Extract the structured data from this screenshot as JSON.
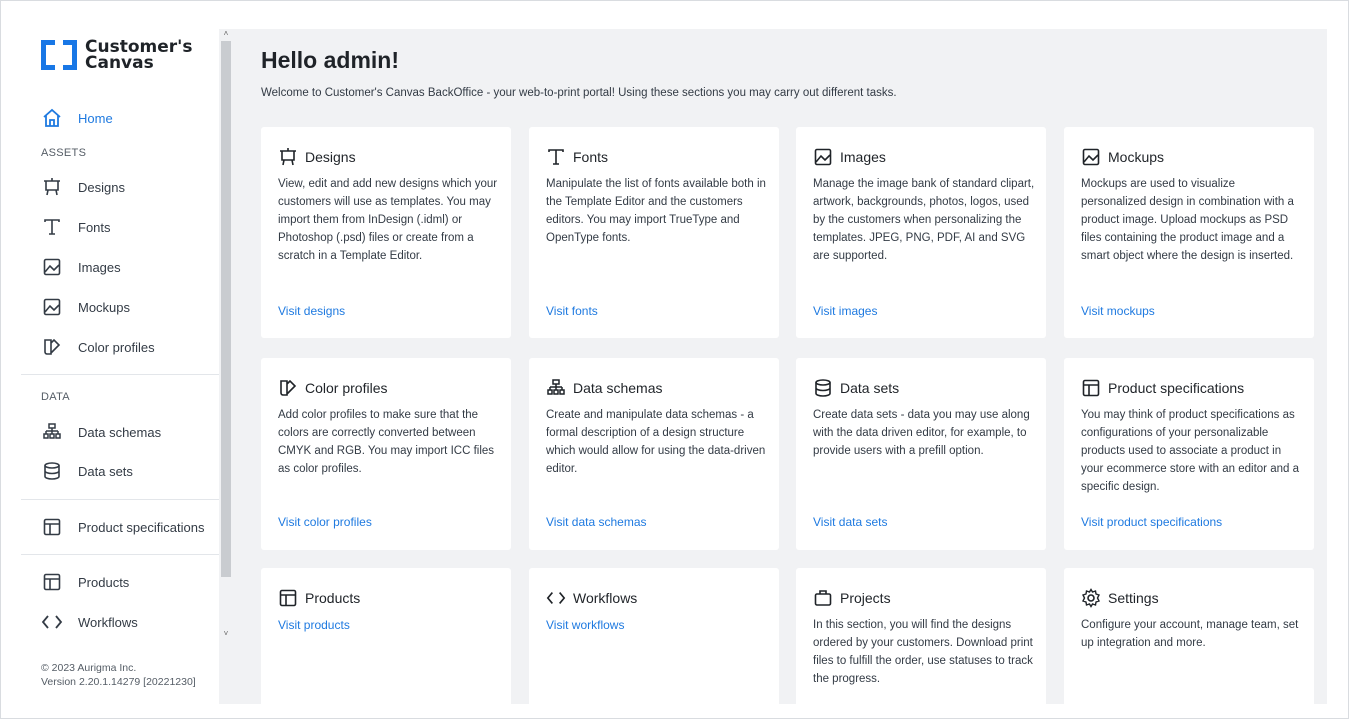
{
  "logo": {
    "line1": "Customer's",
    "line2": "Canvas"
  },
  "sidebar": {
    "home": "Home",
    "assets_label": "ASSETS",
    "assets": [
      {
        "label": "Designs",
        "icon": "easel-icon"
      },
      {
        "label": "Fonts",
        "icon": "font-icon"
      },
      {
        "label": "Images",
        "icon": "image-icon"
      },
      {
        "label": "Mockups",
        "icon": "mockup-icon"
      },
      {
        "label": "Color profiles",
        "icon": "color-profile-icon"
      }
    ],
    "data_label": "DATA",
    "data": [
      {
        "label": "Data schemas",
        "icon": "schema-icon"
      },
      {
        "label": "Data sets",
        "icon": "database-icon"
      }
    ],
    "product_specifications": "Product specifications",
    "products": "Products",
    "workflows": "Workflows",
    "footer_copyright": "© 2023 Aurigma Inc.",
    "footer_version": "Version 2.20.1.14279 [20221230]"
  },
  "main": {
    "title": "Hello admin!",
    "subtitle": "Welcome to Customer's Canvas BackOffice - your web-to-print portal! Using these sections you may carry out different tasks."
  },
  "cards": [
    {
      "title": "Designs",
      "desc": "View, edit and add new designs which your customers will use as templates. You may import them from InDesign (.idml) or Photoshop (.psd) files or create from a scratch in a Template Editor.",
      "link": "Visit designs"
    },
    {
      "title": "Fonts",
      "desc": "Manipulate the list of fonts available both in the Template Editor and the customers editors. You may import TrueType and OpenType fonts.",
      "link": "Visit fonts"
    },
    {
      "title": "Images",
      "desc": "Manage the image bank of standard clipart, artwork, backgrounds, photos, logos, used by the customers when personalizing the templates. JPEG, PNG, PDF, AI and SVG are supported.",
      "link": "Visit images"
    },
    {
      "title": "Mockups",
      "desc": "Mockups are used to visualize personalized design in combination with a product image. Upload mockups as PSD files containing the product image and a smart object where the design is inserted.",
      "link": "Visit mockups"
    },
    {
      "title": "Color profiles",
      "desc": "Add color profiles to make sure that the colors are correctly converted between CMYK and RGB. You may import ICC files as color profiles.",
      "link": "Visit color profiles"
    },
    {
      "title": "Data schemas",
      "desc": "Create and manipulate data schemas - a formal description of a design structure which would allow for using the data-driven editor.",
      "link": "Visit data schemas"
    },
    {
      "title": "Data sets",
      "desc": "Create data sets - data you may use along with the data driven editor, for example, to provide users with a prefill option.",
      "link": "Visit data sets"
    },
    {
      "title": "Product specifications",
      "desc": "You may think of product specifications as configurations of your personalizable products used to associate a product in your ecommerce store with an editor and a specific design.",
      "link": "Visit product specifications"
    },
    {
      "title": "Products",
      "desc": "",
      "link": "Visit products"
    },
    {
      "title": "Workflows",
      "desc": "",
      "link": "Visit workflows"
    },
    {
      "title": "Projects",
      "desc": "In this section, you will find the designs ordered by your customers. Download print files to fulfill the order, use statuses to track the progress.",
      "link": ""
    },
    {
      "title": "Settings",
      "desc": "Configure your account, manage team, set up integration and more.",
      "link": ""
    }
  ],
  "colors": {
    "accent": "#1f7ae0",
    "logo": "#1877e6",
    "background": "#f1f2f4"
  }
}
